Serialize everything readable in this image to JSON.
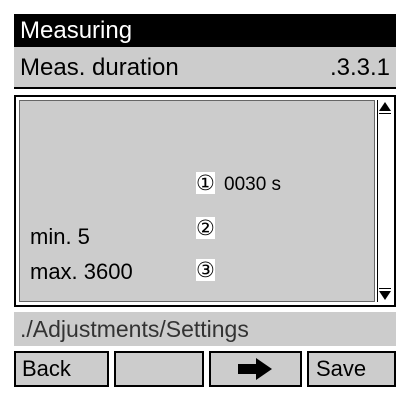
{
  "title": "Measuring",
  "header": {
    "label": "Meas. duration",
    "code": ".3.3.1"
  },
  "panel": {
    "rows": [
      {
        "marker": "①",
        "value": "0030 s"
      },
      {
        "label": "min. 5",
        "marker": "②"
      },
      {
        "label": "max. 3600",
        "marker": "③"
      }
    ]
  },
  "path": "./Adjustments/Settings",
  "buttons": {
    "back": "Back",
    "empty": "",
    "save": "Save",
    "next_icon": "right-arrow-icon"
  },
  "colors": {
    "title_bg": "#000000",
    "panel_bg": "#cccccc",
    "button_bg": "#cccccc"
  }
}
